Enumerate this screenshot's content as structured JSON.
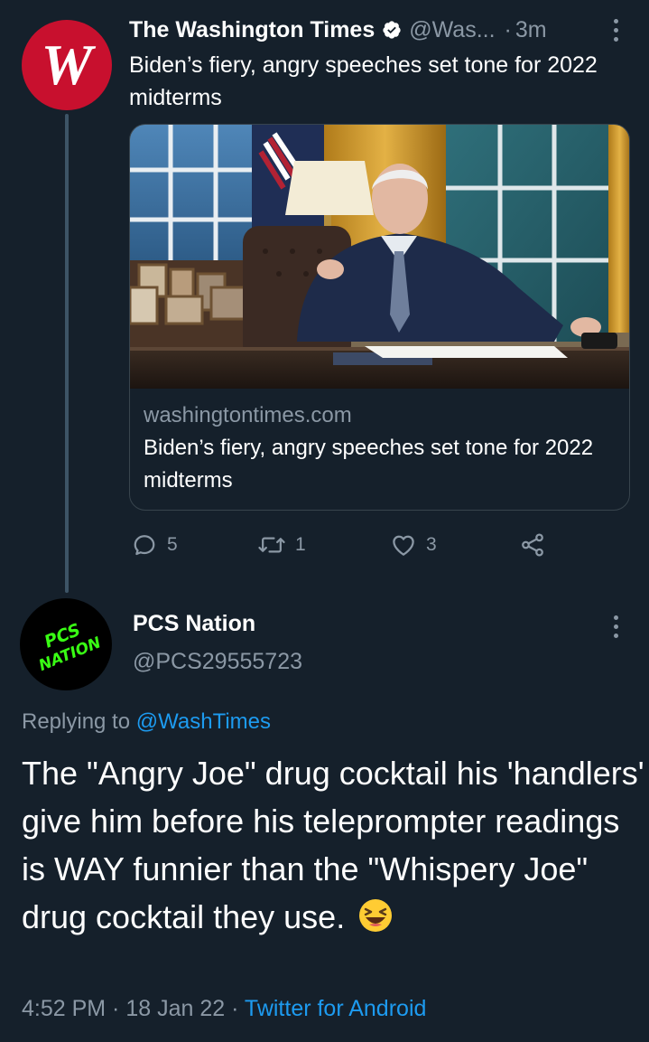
{
  "parent_tweet": {
    "avatar_label": "W",
    "author_name": "The Washington Times",
    "handle": "@Was...",
    "separator": "·",
    "time": "3m",
    "text": "Biden’s fiery, angry speeches set tone for 2022 midterms",
    "card": {
      "domain": "washingtontimes.com",
      "title": "Biden’s fiery, angry speeches set tone for 2022 midterms"
    },
    "actions": {
      "replies": "5",
      "retweets": "1",
      "likes": "3"
    }
  },
  "reply_tweet": {
    "avatar_text_line1": "PCS",
    "avatar_text_line2": "NATION",
    "author_name": "PCS Nation",
    "handle": "@PCS29555723",
    "replying_prefix": "Replying to ",
    "replying_to": "@WashTimes",
    "text": "The \"Angry Joe\" drug cocktail his 'handlers' give him before his teleprompter readings is WAY funnier than the \"Whispery Joe\" drug cocktail they use.",
    "time": "4:52 PM",
    "meta_sep1": " · ",
    "date": "18 Jan 22",
    "meta_sep2": " · ",
    "source": "Twitter for Android"
  },
  "colors": {
    "background": "#15202b",
    "secondary_text": "#8b98a5",
    "link_blue": "#1d9bf0",
    "brand_red": "#c8102e",
    "pcs_green": "#39ff14"
  }
}
